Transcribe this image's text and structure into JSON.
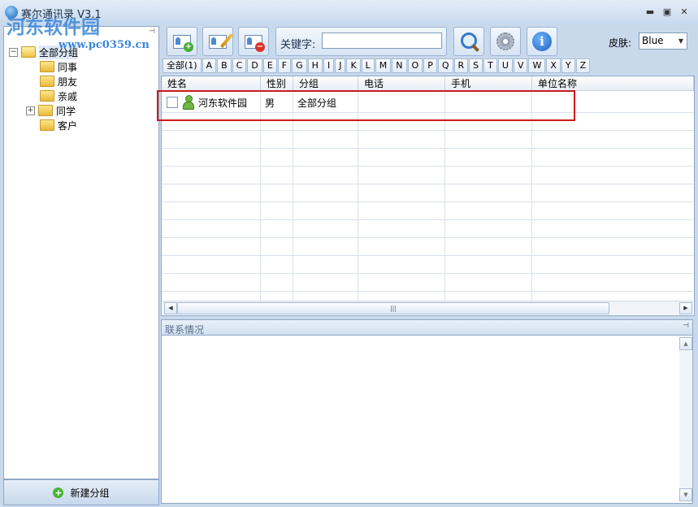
{
  "window": {
    "title": "赛尔通讯录 V3.1",
    "watermark": "河东软件园",
    "watermark_url": "www.pc0359.cn",
    "controls": {
      "minimize": "▬",
      "restore": "▣",
      "close": "✕"
    }
  },
  "sidebar": {
    "pin_icon": "⊣",
    "tree": [
      {
        "label": "全部分组",
        "expander": "−",
        "level": 0
      },
      {
        "label": "同事",
        "level": 1
      },
      {
        "label": "朋友",
        "level": 1
      },
      {
        "label": "亲戚",
        "level": 1
      },
      {
        "label": "同学",
        "expander": "+",
        "level": 1
      },
      {
        "label": "客户",
        "level": 1
      }
    ],
    "new_group_label": "新建分组",
    "new_group_icon": "+"
  },
  "toolbar": {
    "add_badge": "+",
    "delete_badge": "−",
    "keyword_label": "关键字:",
    "keyword_value": "",
    "skin_label": "皮肤:",
    "skin_value": "Blue",
    "skin_arrow": "▼",
    "info_glyph": "i"
  },
  "alpha_filter": [
    "全部(1)",
    "A",
    "B",
    "C",
    "D",
    "E",
    "F",
    "G",
    "H",
    "I",
    "J",
    "K",
    "L",
    "M",
    "N",
    "O",
    "P",
    "Q",
    "R",
    "S",
    "T",
    "U",
    "V",
    "W",
    "X",
    "Y",
    "Z"
  ],
  "table": {
    "columns": [
      "姓名",
      "性别",
      "分组",
      "电话",
      "手机",
      "单位名称"
    ],
    "rows": [
      {
        "name": "河东软件园",
        "gender": "男",
        "group": "全部分组",
        "phone": "",
        "mobile": "",
        "company": ""
      }
    ],
    "scroll_left": "◀",
    "scroll_right": "▶",
    "scroll_thumb": "|||"
  },
  "details": {
    "title": "联系情况",
    "pin_icon": "⊣",
    "scroll_up": "▲",
    "scroll_down": "▼"
  },
  "colors": {
    "highlight_box": "#cc1b1b",
    "accent": "#3a86d8"
  }
}
